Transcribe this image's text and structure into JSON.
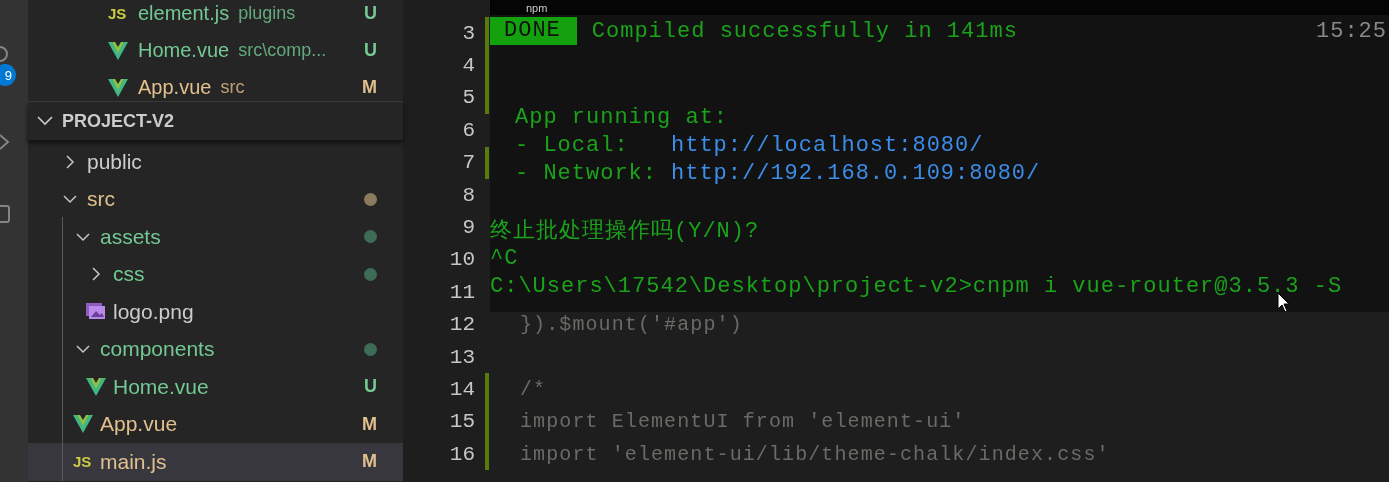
{
  "activity_bar": {
    "badge": "9"
  },
  "open_editors": [
    {
      "icon_text": "JS",
      "kind": "js",
      "name": "element.js",
      "description": "plugins",
      "status": "U"
    },
    {
      "kind": "vue",
      "name": "Home.vue",
      "description": "src\\comp...",
      "status": "U"
    },
    {
      "kind": "vue",
      "name": "App.vue",
      "description": "src",
      "status": "M"
    }
  ],
  "explorer": {
    "title": "PROJECT-V2",
    "expanded": true,
    "tree": [
      {
        "kind": "folder",
        "name": "public",
        "expanded": false
      },
      {
        "kind": "folder",
        "name": "src",
        "expanded": true,
        "modified": true,
        "color": "#8a7a5e",
        "children": [
          {
            "kind": "folder",
            "name": "assets",
            "expanded": true,
            "modified": false,
            "color": "#3d6b55",
            "children": [
              {
                "kind": "folder",
                "name": "css",
                "expanded": false,
                "modified": false,
                "color": "#3d6b55"
              },
              {
                "kind": "image",
                "name": "logo.png"
              }
            ]
          },
          {
            "kind": "folder",
            "name": "components",
            "expanded": true,
            "modified": false,
            "color": "#3d6b55",
            "children": [
              {
                "kind": "vue",
                "name": "Home.vue",
                "status": "U"
              }
            ]
          },
          {
            "kind": "vue",
            "name": "App.vue",
            "status": "M"
          },
          {
            "kind": "js",
            "icon_text": "JS",
            "name": "main.js",
            "status": "M",
            "selected": true
          }
        ]
      }
    ]
  },
  "editor": {
    "lines": [
      {
        "number": "3",
        "changed": true
      },
      {
        "number": "4",
        "changed": true
      },
      {
        "number": "5",
        "changed": true
      },
      {
        "number": "6",
        "changed": false
      },
      {
        "number": "7",
        "changed": true
      },
      {
        "number": "8",
        "changed": false
      },
      {
        "number": "9",
        "changed": false
      },
      {
        "number": "10",
        "changed": false
      },
      {
        "number": "11",
        "changed": false
      },
      {
        "number": "12",
        "code": "}).$mount('#app')",
        "changed": false
      },
      {
        "number": "13",
        "changed": false
      },
      {
        "number": "14",
        "code": "/*",
        "changed": true
      },
      {
        "number": "15",
        "code": "import ElementUI from 'element-ui'",
        "changed": true
      },
      {
        "number": "16",
        "code": "import 'element-ui/lib/theme-chalk/index.css'",
        "changed": true
      }
    ]
  },
  "terminal": {
    "title": "npm",
    "blocks": [
      [
        {
          "indent": false,
          "segments": [
            {
              "kind": "badge",
              "text": "DONE"
            },
            {
              "kind": "green",
              "text": "Compiled successfully in 141ms"
            }
          ],
          "time": "15:25"
        }
      ],
      [
        {
          "indent": true,
          "segments": [
            {
              "kind": "green",
              "text": "App running at:"
            }
          ]
        },
        {
          "indent": true,
          "segments": [
            {
              "kind": "green",
              "text": "- Local:"
            },
            {
              "kind": "link",
              "text": "http://localhost:8080/"
            }
          ]
        },
        {
          "indent": true,
          "segments": [
            {
              "kind": "green",
              "text": "- Network:"
            },
            {
              "kind": "link",
              "text": "http://192.168.0.109:8080/"
            }
          ]
        }
      ],
      [
        {
          "indent": false,
          "segments": [
            {
              "kind": "green",
              "text": "终止批处理操作吗(Y/N)?"
            }
          ]
        },
        {
          "indent": false,
          "segments": [
            {
              "kind": "green",
              "text": "^C"
            }
          ]
        },
        {
          "indent": false,
          "segments": [
            {
              "kind": "green",
              "text": "C:\\Users\\17542\\Desktop\\project-v2>cnpm i vue-router@3.5.3 -S"
            }
          ]
        }
      ]
    ]
  }
}
